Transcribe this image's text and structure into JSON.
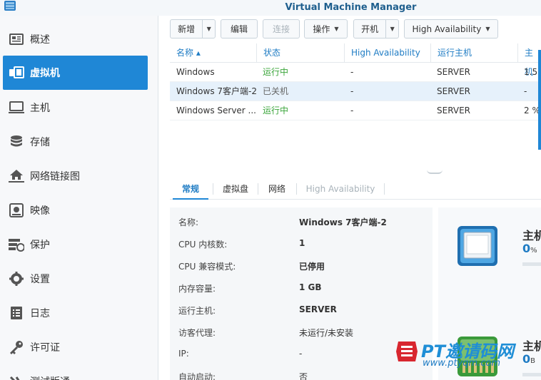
{
  "app": {
    "title": "Virtual Machine Manager"
  },
  "sidebar": {
    "items": [
      {
        "label": "概述",
        "icon": "overview-icon"
      },
      {
        "label": "虚拟机",
        "icon": "virtual-machine-icon",
        "active": true
      },
      {
        "label": "主机",
        "icon": "host-icon"
      },
      {
        "label": "存储",
        "icon": "storage-icon"
      },
      {
        "label": "网络链接图",
        "icon": "network-icon"
      },
      {
        "label": "映像",
        "icon": "image-icon"
      },
      {
        "label": "保护",
        "icon": "protection-icon"
      },
      {
        "label": "设置",
        "icon": "settings-icon"
      },
      {
        "label": "日志",
        "icon": "log-icon"
      },
      {
        "label": "许可证",
        "icon": "license-key-icon"
      },
      {
        "label": "测试版通",
        "icon": "beta-icon"
      }
    ]
  },
  "toolbar": {
    "new_label": "新增",
    "edit_label": "编辑",
    "connect_label": "连接",
    "action_label": "操作",
    "power_on_label": "开机",
    "ha_label": "High Availability"
  },
  "vm_table": {
    "columns": [
      "名称 ▴",
      "状态",
      "High Availability",
      "运行主机",
      "主机"
    ],
    "rows": [
      {
        "name": "Windows",
        "status": "运行中",
        "ha": "-",
        "host": "SERVER",
        "usage": "1.5"
      },
      {
        "name": "Windows 7客户端-2",
        "status": "已关机",
        "ha": "-",
        "host": "SERVER",
        "usage": "-"
      },
      {
        "name": "Windows Server ...",
        "status": "运行中",
        "ha": "-",
        "host": "SERVER",
        "usage": "2 %"
      }
    ]
  },
  "detail_tabs": [
    "常规",
    "虚拟盘",
    "网络",
    "High Availability"
  ],
  "info": [
    {
      "label": "名称:",
      "value": "Windows 7客户端-2"
    },
    {
      "label": "CPU 内核数:",
      "value": "1"
    },
    {
      "label": "CPU 兼容模式:",
      "value": "已停用"
    },
    {
      "label": "内存容量:",
      "value": "1 GB"
    },
    {
      "label": "运行主机:",
      "value": "SERVER"
    },
    {
      "label": "访客代理:",
      "value": "未运行/未安装"
    },
    {
      "label": "IP:",
      "value": "-"
    },
    {
      "label": "自动启动:",
      "value": "否"
    }
  ],
  "host_panel": {
    "cpu_title": "主机",
    "cpu_value": "0",
    "cpu_unit": "%",
    "mem_title": "主机",
    "mem_value": "0",
    "mem_unit": "B"
  },
  "watermark": {
    "text": "PT邀请码网",
    "url": "www.ptyqm.com"
  },
  "colors": {
    "accent": "#1f87d6",
    "running": "#3aa53a",
    "title": "#1f5f8e"
  }
}
